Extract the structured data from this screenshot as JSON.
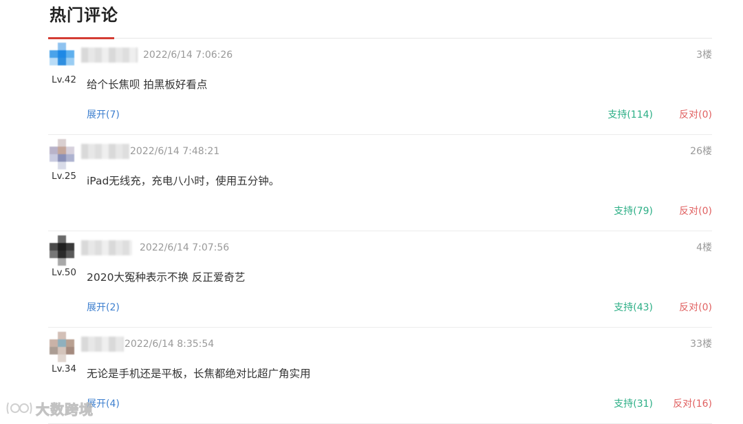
{
  "section": {
    "title": "热门评论",
    "accent_color": "#d43c33"
  },
  "comments": [
    {
      "level": "Lv.42",
      "time": "2022/6/14 7:06:26",
      "floor": "3楼",
      "content": "给个长焦呗 拍黑板好看点",
      "expand": "展开(7)",
      "support": "支持(114)",
      "oppose": "反对(0)"
    },
    {
      "level": "Lv.25",
      "time": "2022/6/14 7:48:21",
      "floor": "26楼",
      "content": "iPad无线充，充电八小时，使用五分钟。",
      "expand": "",
      "support": "支持(79)",
      "oppose": "反对(0)"
    },
    {
      "level": "Lv.50",
      "time": "2022/6/14 7:07:56",
      "floor": "4楼",
      "content": "2020大冤种表示不换 反正爱奇艺",
      "expand": "展开(2)",
      "support": "支持(43)",
      "oppose": "反对(0)"
    },
    {
      "level": "Lv.34",
      "time": "2022/6/14 8:35:54",
      "floor": "33楼",
      "content": "无论是手机还是平板，长焦都绝对比超广角实用",
      "expand": "展开(4)",
      "support": "支持(31)",
      "oppose": "反对(16)"
    }
  ],
  "watermark": {
    "text": "大数跨境"
  },
  "colors": {
    "link": "#3d7fcf",
    "support": "#2bae85",
    "oppose": "#e06060",
    "meta": "#999999"
  }
}
